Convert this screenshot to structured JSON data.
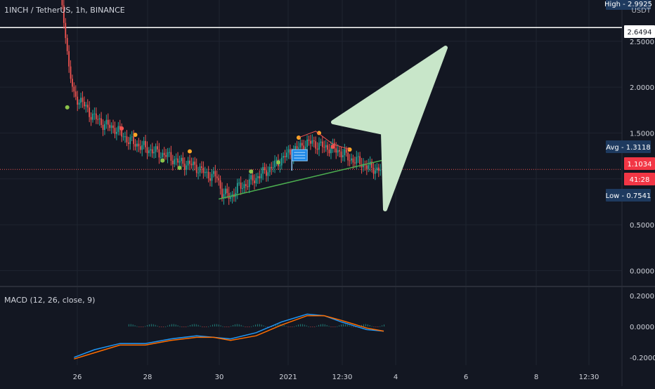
{
  "header": {
    "symbol_line": "1INCH / TetherUS, 1h, BINANCE",
    "currency": "USDT"
  },
  "price_badges": {
    "high": "High - 2.9925",
    "avg": "Avg - 1.3118",
    "last": "1.1034",
    "countdown": "41:28",
    "low": "Low - 0.7541",
    "horizontal_level": "2.6494"
  },
  "macd": {
    "title": "MACD (12, 26, close, 9)",
    "ticks": [
      "0.2000",
      "0.0000",
      "-0.2000"
    ]
  },
  "colors": {
    "background": "#131722",
    "grid": "#1f2430",
    "axis_text": "#d1d4dc",
    "bull": "#26a69a",
    "bear": "#ef5350",
    "horizontal_line": "#ffffff",
    "trendline": "#4caf50",
    "arrow": "#c8e6c9",
    "macd_line": "#2196f3",
    "signal_line": "#ff6d00",
    "badge_blue": "#1e3a5f",
    "badge_red": "#f23645",
    "price_line": "#ef5350"
  },
  "chart_data": {
    "type": "candlestick",
    "title": "1INCH / TetherUS, 1h, BINANCE",
    "ylabel": "USDT",
    "y_ticks": [
      "2.5000",
      "2.0000",
      "1.5000",
      "1.0000",
      "0.5000",
      "0.0000"
    ],
    "x_ticks": [
      "26",
      "28",
      "30",
      "2021",
      "12:30",
      "4",
      "6",
      "8",
      "12:30"
    ],
    "ylim": [
      -0.15,
      2.95
    ],
    "x_range_hours": [
      0,
      330
    ],
    "price_path": [
      [
        0,
        2.95
      ],
      [
        3,
        2.6
      ],
      [
        5,
        2.2
      ],
      [
        8,
        1.9
      ],
      [
        12,
        1.85
      ],
      [
        18,
        1.7
      ],
      [
        25,
        1.6
      ],
      [
        32,
        1.55
      ],
      [
        40,
        1.42
      ],
      [
        48,
        1.35
      ],
      [
        55,
        1.3
      ],
      [
        63,
        1.25
      ],
      [
        70,
        1.18
      ],
      [
        78,
        1.15
      ],
      [
        86,
        1.05
      ],
      [
        92,
        1.02
      ],
      [
        95,
        0.85
      ],
      [
        100,
        0.8
      ],
      [
        104,
        0.9
      ],
      [
        110,
        0.95
      ],
      [
        118,
        1.05
      ],
      [
        126,
        1.15
      ],
      [
        132,
        1.25
      ],
      [
        138,
        1.32
      ],
      [
        144,
        1.38
      ],
      [
        148,
        1.4
      ],
      [
        152,
        1.36
      ],
      [
        158,
        1.34
      ],
      [
        164,
        1.3
      ],
      [
        170,
        1.22
      ],
      [
        176,
        1.18
      ],
      [
        182,
        1.12
      ],
      [
        188,
        1.1
      ]
    ],
    "horizontal_level": 2.6494,
    "last_price": 1.1034,
    "trendline": [
      [
        93,
        0.78
      ],
      [
        200,
        1.25
      ]
    ],
    "markers": {
      "green": [
        [
          4,
          1.78
        ],
        [
          60,
          1.2
        ],
        [
          70,
          1.12
        ],
        [
          112,
          1.08
        ],
        [
          128,
          1.18
        ]
      ],
      "orange": [
        [
          44,
          1.48
        ],
        [
          76,
          1.3
        ],
        [
          140,
          1.45
        ],
        [
          152,
          1.5
        ],
        [
          170,
          1.32
        ]
      ],
      "red": [
        [
          36,
          1.55
        ],
        [
          160,
          1.35
        ]
      ]
    },
    "macd_ylim": [
      -0.25,
      0.25
    ],
    "macd_series": [
      {
        "name": "MACD",
        "points": [
          [
            8,
            -0.2
          ],
          [
            20,
            -0.15
          ],
          [
            35,
            -0.11
          ],
          [
            50,
            -0.11
          ],
          [
            65,
            -0.08
          ],
          [
            80,
            -0.06
          ],
          [
            90,
            -0.07
          ],
          [
            100,
            -0.08
          ],
          [
            115,
            -0.04
          ],
          [
            130,
            0.03
          ],
          [
            145,
            0.08
          ],
          [
            155,
            0.07
          ],
          [
            165,
            0.03
          ],
          [
            180,
            -0.02
          ],
          [
            190,
            -0.03
          ]
        ]
      },
      {
        "name": "Signal",
        "points": [
          [
            8,
            -0.21
          ],
          [
            20,
            -0.17
          ],
          [
            35,
            -0.12
          ],
          [
            50,
            -0.12
          ],
          [
            65,
            -0.09
          ],
          [
            80,
            -0.07
          ],
          [
            90,
            -0.07
          ],
          [
            100,
            -0.09
          ],
          [
            115,
            -0.06
          ],
          [
            130,
            0.01
          ],
          [
            145,
            0.07
          ],
          [
            155,
            0.07
          ],
          [
            165,
            0.04
          ],
          [
            180,
            -0.01
          ],
          [
            190,
            -0.03
          ]
        ]
      }
    ]
  }
}
